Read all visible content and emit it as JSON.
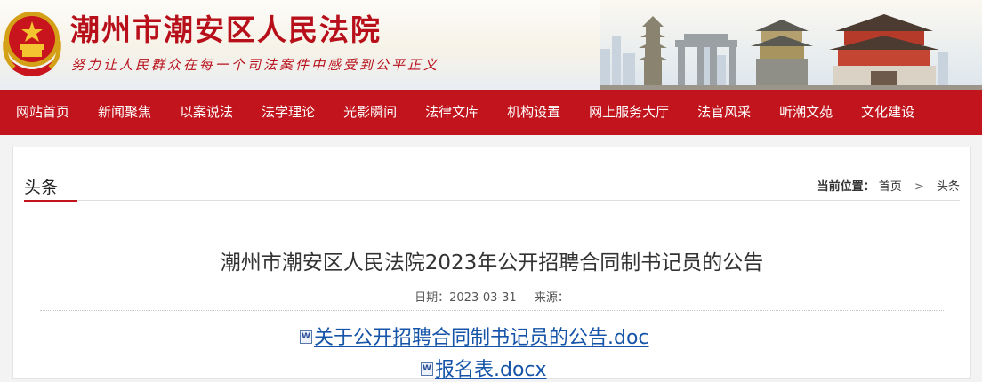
{
  "header": {
    "site_title": "潮州市潮安区人民法院",
    "slogan": "努力让人民群众在每一个司法案件中感受到公平正义",
    "emblem_icon": "national-emblem-icon",
    "colors": {
      "brand_red": "#b8101a",
      "nav_red": "#c1141c"
    }
  },
  "nav": {
    "items": [
      {
        "label": "网站首页"
      },
      {
        "label": "新闻聚焦"
      },
      {
        "label": "以案说法"
      },
      {
        "label": "法学理论"
      },
      {
        "label": "光影瞬间"
      },
      {
        "label": "法律文库"
      },
      {
        "label": "机构设置"
      },
      {
        "label": "网上服务大厅"
      },
      {
        "label": "法官风采"
      },
      {
        "label": "听潮文苑"
      },
      {
        "label": "文化建设"
      }
    ]
  },
  "section": {
    "title": "头条",
    "breadcrumb": {
      "label": "当前位置：",
      "items": [
        "首页",
        "头条"
      ]
    }
  },
  "article": {
    "title": "潮州市潮安区人民法院2023年公开招聘合同制书记员的公告",
    "date_label": "日期：2023-03-31",
    "source_label": "来源："
  },
  "attachments": [
    {
      "name": "关于公开招聘合同制书记员的公告.doc",
      "icon": "word-doc-icon"
    },
    {
      "name": "报名表.docx",
      "icon": "word-doc-icon"
    }
  ]
}
